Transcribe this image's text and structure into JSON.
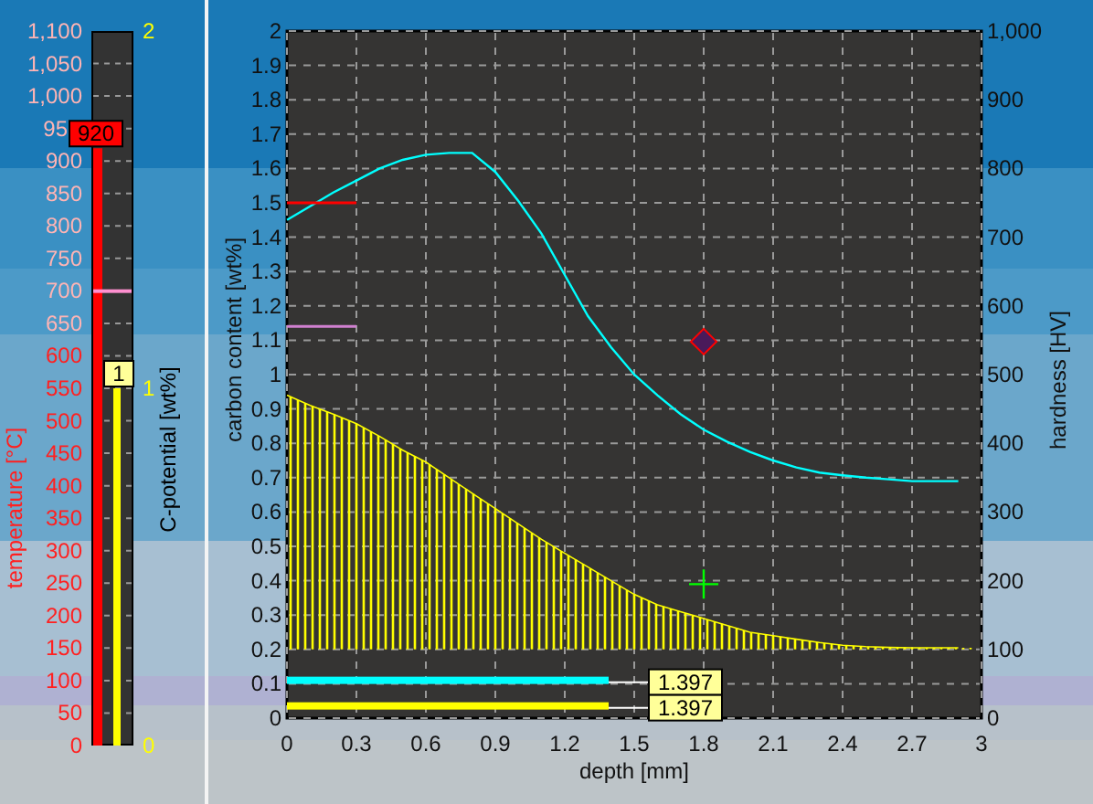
{
  "temperature_gauge": {
    "axis_title": "temperature [°C]",
    "ticks": [
      "1,100",
      "1,050",
      "1,000",
      "95",
      "900",
      "850",
      "800",
      "750",
      "700",
      "650",
      "600",
      "550",
      "500",
      "450",
      "400",
      "350",
      "300",
      "250",
      "200",
      "150",
      "100",
      "50",
      "0"
    ],
    "reading": "920",
    "level": 0.836,
    "setpoint": {
      "level": 0.636
    }
  },
  "c_potential_gauge": {
    "axis_title": "C-potential [wt%]",
    "ticks": [
      "2",
      "1",
      "0"
    ],
    "reading": "1",
    "level": 0.5
  },
  "profile_chart": {
    "y2_title": "hardness [HV]",
    "y2_ticks": [
      "1,000",
      "900",
      "800",
      "700",
      "600",
      "500",
      "400",
      "300",
      "200",
      "100",
      "0"
    ],
    "depth_bars": [
      {
        "color": "#00ffff",
        "value": "1.397"
      },
      {
        "color": "#ffff00",
        "value": "1.397"
      }
    ],
    "chart_data": {
      "type": "line",
      "xlabel": "depth [mm]",
      "ylabel": "carbon content [wt%]",
      "xlim": [
        0,
        3
      ],
      "ylim": [
        0,
        2
      ],
      "grid": true,
      "xticks": [
        0,
        0.3,
        0.6,
        0.9,
        1.2,
        1.5,
        1.8,
        2.1,
        2.4,
        2.7,
        3
      ],
      "yticks": [
        0,
        0.1,
        0.2,
        0.3,
        0.4,
        0.5,
        0.6,
        0.7,
        0.8,
        0.9,
        1,
        1.1,
        1.2,
        1.3,
        1.4,
        1.5,
        1.6,
        1.7,
        1.8,
        1.9,
        2
      ],
      "x": [
        0,
        0.1,
        0.2,
        0.3,
        0.4,
        0.5,
        0.6,
        0.7,
        0.8,
        0.9,
        1,
        1.1,
        1.2,
        1.3,
        1.4,
        1.5,
        1.6,
        1.7,
        1.8,
        1.9,
        2,
        2.1,
        2.2,
        2.3,
        2.4,
        2.5,
        2.6,
        2.7,
        2.8,
        2.9
      ],
      "series": [
        {
          "color": "#00ffff",
          "values": [
            1.45,
            1.49,
            1.53,
            1.565,
            1.6,
            1.625,
            1.64,
            1.645,
            1.645,
            1.59,
            1.505,
            1.41,
            1.29,
            1.17,
            1.08,
            1.0,
            0.94,
            0.885,
            0.84,
            0.805,
            0.775,
            0.75,
            0.73,
            0.715,
            0.707,
            0.7,
            0.695,
            0.69,
            0.69,
            0.69
          ]
        },
        {
          "color": "#ffff00",
          "values": [
            0.94,
            0.91,
            0.885,
            0.857,
            0.82,
            0.78,
            0.745,
            0.7,
            0.655,
            0.61,
            0.565,
            0.52,
            0.48,
            0.44,
            0.4,
            0.36,
            0.33,
            0.31,
            0.29,
            0.27,
            0.25,
            0.24,
            0.23,
            0.22,
            0.212,
            0.208,
            0.206,
            0.205,
            0.205,
            0.205
          ]
        }
      ]
    }
  }
}
